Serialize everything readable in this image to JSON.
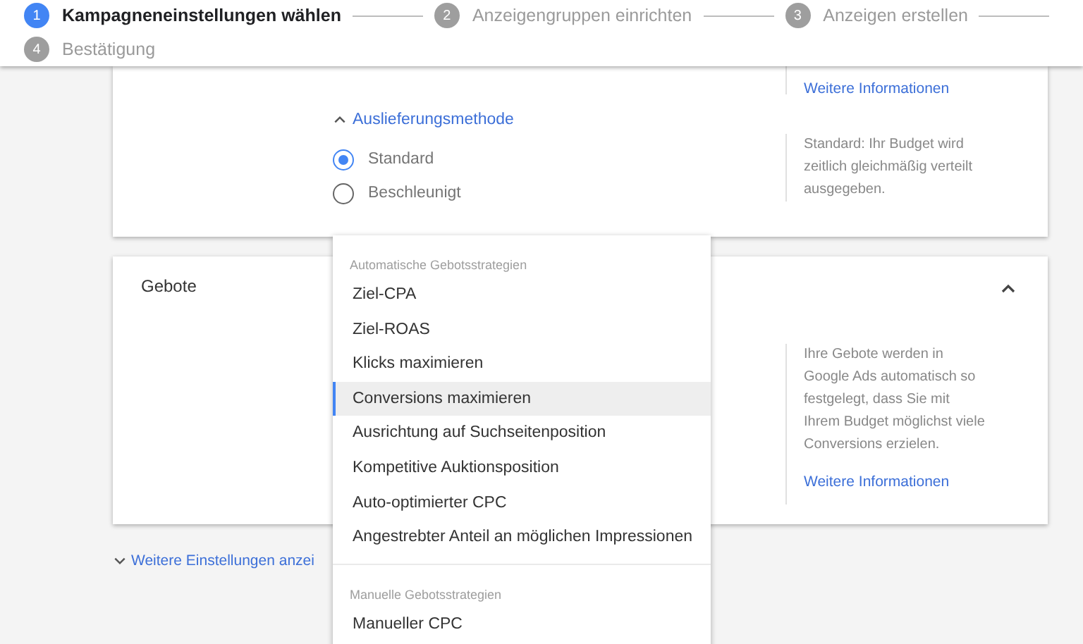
{
  "stepper": [
    {
      "number": "1",
      "label": "Kampagneneinstellungen wählen",
      "selected": true
    },
    {
      "number": "2",
      "label": "Anzeigengruppen einrichten",
      "selected": false
    },
    {
      "number": "3",
      "label": "Anzeigen erstellen",
      "selected": false
    },
    {
      "number": "4",
      "label": "Bestätigung",
      "selected": false
    }
  ],
  "delivery_card": {
    "info_link": "Weitere Informationen",
    "section_toggle": {
      "label": "Auslieferungsmethode",
      "expanded": true
    },
    "options": [
      {
        "label": "Standard",
        "selected": true
      },
      {
        "label": "Beschleunigt",
        "selected": false
      }
    ],
    "help_text": "Standard: Ihr Budget wird zeitlich gleichmäßig verteilt ausgegeben."
  },
  "bids_card": {
    "title": "Gebote",
    "expanded": true,
    "help_text": "Ihre Gebote werden in Google Ads automatisch so festgelegt, dass Sie mit Ihrem Budget möglichst viele Conversions erzielen.",
    "info_link": "Weitere Informationen"
  },
  "more_settings": {
    "label": "Weitere Einstellungen anzei",
    "expanded": false
  },
  "strategy_menu": [
    {
      "heading": "Automatische Gebotsstrategien",
      "items": [
        {
          "label": "Ziel-CPA",
          "selected": false
        },
        {
          "label": "Ziel-ROAS",
          "selected": false
        },
        {
          "label": "Klicks maximieren",
          "selected": false
        },
        {
          "label": "Conversions maximieren",
          "selected": true
        },
        {
          "label": "Ausrichtung auf Suchseitenposition",
          "selected": false
        },
        {
          "label": "Kompetitive Auktionsposition",
          "selected": false
        },
        {
          "label": "Auto-optimierter CPC",
          "selected": false
        },
        {
          "label": "Angestrebter Anteil an möglichen Impressionen",
          "selected": false
        }
      ]
    },
    {
      "heading": "Manuelle Gebotsstrategien",
      "items": [
        {
          "label": "Manueller CPC",
          "selected": false
        }
      ]
    }
  ]
}
